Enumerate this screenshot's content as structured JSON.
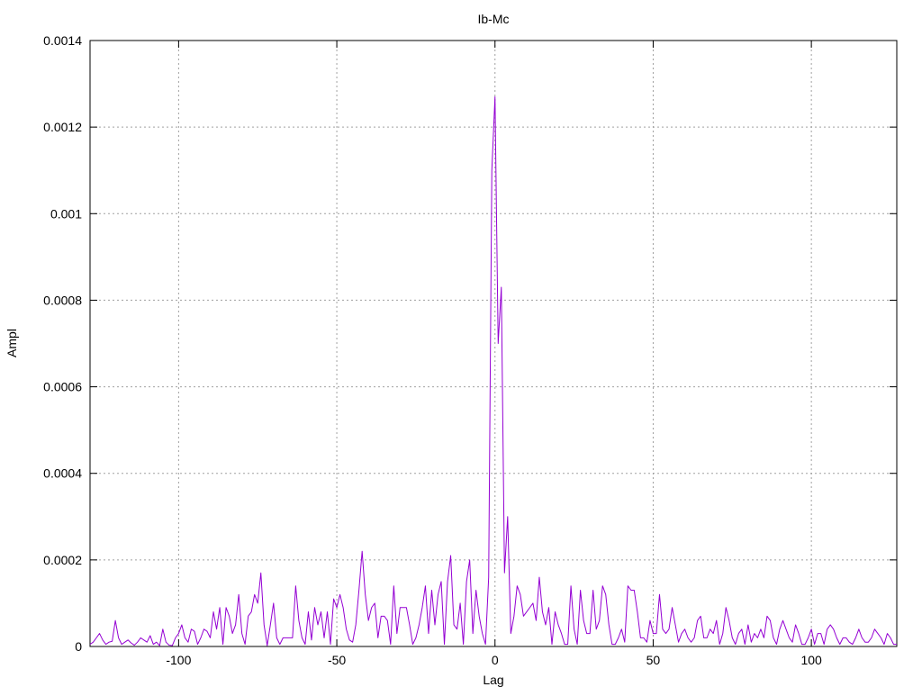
{
  "chart_data": {
    "type": "line",
    "title": "Ib-Mc",
    "xlabel": "Lag",
    "ylabel": "Ampl",
    "xlim": [
      -128,
      127
    ],
    "ylim": [
      0,
      0.0014
    ],
    "xticks": [
      -100,
      -50,
      0,
      50,
      100
    ],
    "xtick_labels": [
      "-100",
      "-50",
      "0",
      "50",
      "100"
    ],
    "yticks": [
      0,
      0.0002,
      0.0004,
      0.0006,
      0.0008,
      0.001,
      0.0012,
      0.0014
    ],
    "ytick_labels": [
      "0",
      "0.0002",
      "0.0004",
      "0.0006",
      "0.0008",
      "0.001",
      "0.0012",
      "0.0014"
    ],
    "grid": true,
    "legend": "none",
    "colors": {
      "series": "#9400d3"
    },
    "series": [
      {
        "x": [
          -128,
          -127,
          -126,
          -125,
          -124,
          -123,
          -122,
          -121,
          -120,
          -119,
          -118,
          -117,
          -116,
          -115,
          -114,
          -113,
          -112,
          -111,
          -110,
          -109,
          -108,
          -107,
          -106,
          -105,
          -104,
          -103,
          -102,
          -101,
          -100,
          -99,
          -98,
          -97,
          -96,
          -95,
          -94,
          -93,
          -92,
          -91,
          -90,
          -89,
          -88,
          -87,
          -86,
          -85,
          -84,
          -83,
          -82,
          -81,
          -80,
          -79,
          -78,
          -77,
          -76,
          -75,
          -74,
          -73,
          -72,
          -71,
          -70,
          -69,
          -68,
          -67,
          -66,
          -65,
          -64,
          -63,
          -62,
          -61,
          -60,
          -59,
          -58,
          -57,
          -56,
          -55,
          -54,
          -53,
          -52,
          -51,
          -50,
          -49,
          -48,
          -47,
          -46,
          -45,
          -44,
          -43,
          -42,
          -41,
          -40,
          -39,
          -38,
          -37,
          -36,
          -35,
          -34,
          -33,
          -32,
          -31,
          -30,
          -29,
          -28,
          -27,
          -26,
          -25,
          -24,
          -23,
          -22,
          -21,
          -20,
          -19,
          -18,
          -17,
          -16,
          -15,
          -14,
          -13,
          -12,
          -11,
          -10,
          -9,
          -8,
          -7,
          -6,
          -5,
          -4,
          -3,
          -2,
          -1,
          0,
          1,
          2,
          3,
          4,
          5,
          6,
          7,
          8,
          9,
          10,
          11,
          12,
          13,
          14,
          15,
          16,
          17,
          18,
          19,
          20,
          21,
          22,
          23,
          24,
          25,
          26,
          27,
          28,
          29,
          30,
          31,
          32,
          33,
          34,
          35,
          36,
          37,
          38,
          39,
          40,
          41,
          42,
          43,
          44,
          45,
          46,
          47,
          48,
          49,
          50,
          51,
          52,
          53,
          54,
          55,
          56,
          57,
          58,
          59,
          60,
          61,
          62,
          63,
          64,
          65,
          66,
          67,
          68,
          69,
          70,
          71,
          72,
          73,
          74,
          75,
          76,
          77,
          78,
          79,
          80,
          81,
          82,
          83,
          84,
          85,
          86,
          87,
          88,
          89,
          90,
          91,
          92,
          93,
          94,
          95,
          96,
          97,
          98,
          99,
          100,
          101,
          102,
          103,
          104,
          105,
          106,
          107,
          108,
          109,
          110,
          111,
          112,
          113,
          114,
          115,
          116,
          117,
          118,
          119,
          120,
          121,
          122,
          123,
          124,
          125,
          126,
          127
        ],
        "y": [
          5e-06,
          1e-05,
          2e-05,
          3e-05,
          1.5e-05,
          5e-06,
          1e-05,
          1.2e-05,
          6e-05,
          2e-05,
          5e-06,
          1e-05,
          1.5e-05,
          8e-06,
          3e-06,
          1e-05,
          2e-05,
          1.5e-05,
          1e-05,
          2.5e-05,
          5e-06,
          1e-05,
          2e-06,
          4e-05,
          1e-05,
          3e-06,
          2e-06,
          2e-05,
          3e-05,
          5e-05,
          2e-05,
          1e-05,
          4e-05,
          3.5e-05,
          5e-06,
          2e-05,
          4e-05,
          3.5e-05,
          2e-05,
          8e-05,
          4e-05,
          9e-05,
          5e-06,
          9e-05,
          7e-05,
          3e-05,
          5e-05,
          0.00012,
          3e-05,
          5e-06,
          7e-05,
          8e-05,
          0.00012,
          0.0001,
          0.00017,
          5e-05,
          2e-06,
          5e-05,
          0.0001,
          2e-05,
          5e-06,
          2e-05,
          2e-05,
          2e-05,
          2e-05,
          0.00014,
          6e-05,
          2e-05,
          5e-06,
          8e-05,
          1.5e-05,
          9e-05,
          5e-05,
          8e-05,
          2e-05,
          8e-05,
          5e-06,
          0.00011,
          9e-05,
          0.00012,
          9e-05,
          4e-05,
          1.5e-05,
          1e-05,
          5e-05,
          0.00013,
          0.00022,
          0.00012,
          6e-05,
          9e-05,
          0.0001,
          2e-05,
          7e-05,
          7e-05,
          6e-05,
          5e-06,
          0.00014,
          3e-05,
          9e-05,
          9e-05,
          9e-05,
          5e-05,
          5e-06,
          2e-05,
          5e-05,
          9e-05,
          0.00014,
          3e-05,
          0.00013,
          5e-05,
          0.00012,
          0.00015,
          5e-06,
          0.00015,
          0.00021,
          5e-05,
          4e-05,
          0.0001,
          5e-06,
          0.00015,
          0.0002,
          3e-05,
          0.00013,
          7e-05,
          3e-05,
          5e-06,
          0.00016,
          0.0011,
          0.00127,
          0.0007,
          0.00083,
          0.00017,
          0.0003,
          3e-05,
          7e-05,
          0.00014,
          0.00012,
          7e-05,
          8e-05,
          9e-05,
          0.0001,
          6e-05,
          0.00016,
          8e-05,
          5e-05,
          9e-05,
          5e-06,
          8e-05,
          5e-05,
          3e-05,
          5e-06,
          5e-06,
          0.00014,
          4e-05,
          5e-06,
          0.00013,
          6e-05,
          3e-05,
          3e-05,
          0.00013,
          4e-05,
          6e-05,
          0.00014,
          0.00012,
          5e-05,
          5e-06,
          5e-06,
          2e-05,
          4e-05,
          1e-05,
          0.00014,
          0.00013,
          0.00013,
          8e-05,
          2e-05,
          2e-05,
          1e-05,
          6e-05,
          3e-05,
          3e-05,
          0.00012,
          4e-05,
          3e-05,
          4e-05,
          9e-05,
          5e-05,
          1e-05,
          3e-05,
          4e-05,
          2e-05,
          1e-05,
          2e-05,
          6e-05,
          7e-05,
          2e-05,
          2e-05,
          4e-05,
          3e-05,
          6e-05,
          5e-06,
          3e-05,
          9e-05,
          6e-05,
          2e-05,
          5e-06,
          3e-05,
          4e-05,
          5e-06,
          5e-05,
          1e-05,
          3e-05,
          2e-05,
          4e-05,
          2e-05,
          7e-05,
          6e-05,
          2e-05,
          5e-06,
          4e-05,
          6e-05,
          4e-05,
          2e-05,
          1e-05,
          5e-05,
          3e-05,
          5e-06,
          5e-06,
          2e-05,
          4e-05,
          5e-06,
          3e-05,
          3e-05,
          5e-06,
          4e-05,
          5e-05,
          4e-05,
          2e-05,
          5e-06,
          2e-05,
          2e-05,
          1e-05,
          5e-06,
          2e-05,
          4e-05,
          2e-05,
          1e-05,
          1e-05,
          2e-05,
          4e-05,
          3e-05,
          2e-05,
          5e-06,
          3e-05,
          2e-05,
          5e-06,
          5e-06
        ]
      }
    ]
  }
}
